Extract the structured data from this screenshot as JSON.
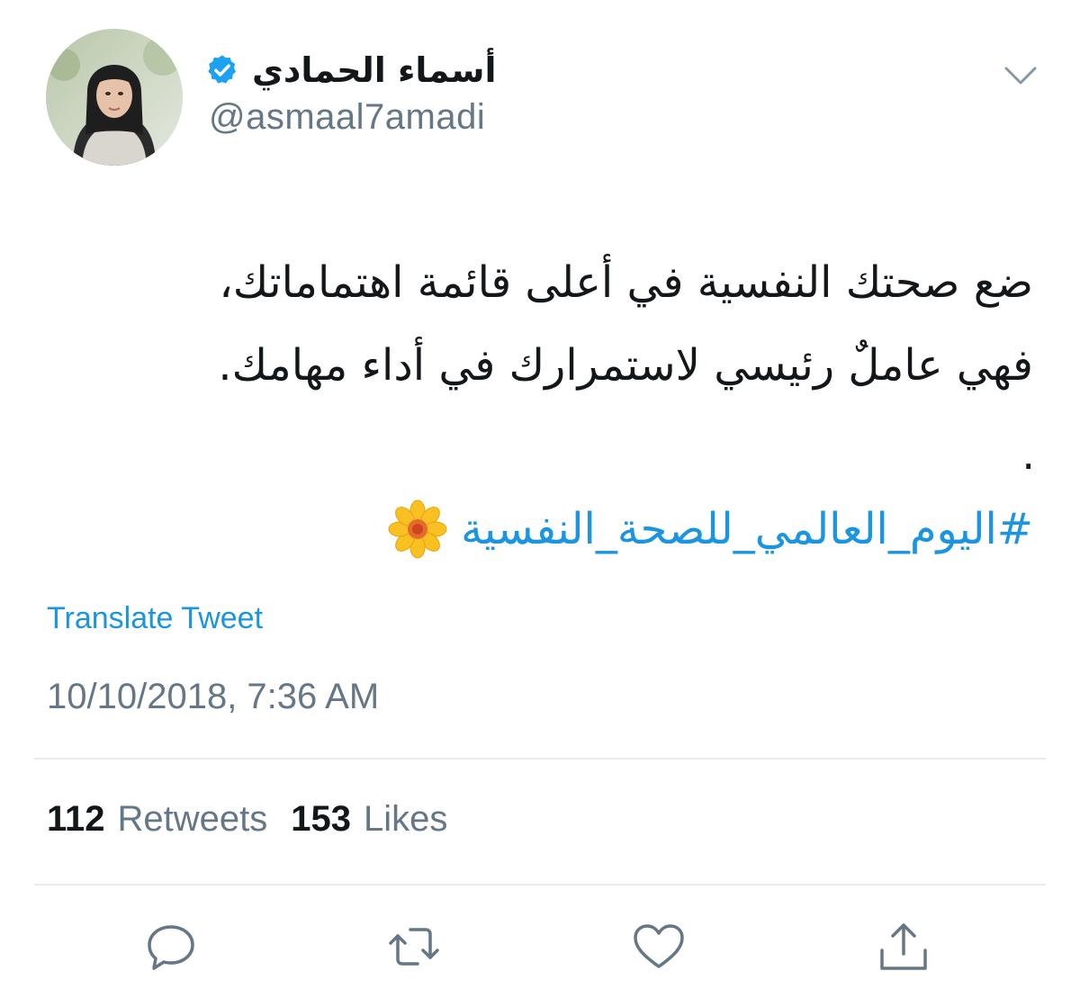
{
  "user": {
    "display_name": "أسماء الحمادي",
    "handle": "@asmaal7amadi",
    "verified": true
  },
  "tweet": {
    "lines": [
      "ضع صحتك النفسية في أعلى قائمة اهتماماتك،",
      "فهي عاملٌ رئيسي لاستمرارك في أداء مهامك."
    ],
    "dot": ".",
    "hashtag": "#اليوم_العالمي_للصحة_النفسية",
    "translate_label": "Translate Tweet",
    "timestamp": "10/10/2018, 7:36 AM"
  },
  "stats": {
    "retweets_count": "112",
    "retweets_label": "Retweets",
    "likes_count": "153",
    "likes_label": "Likes"
  },
  "icons": {
    "verified": "verified-badge-icon",
    "menu": "chevron-down-icon",
    "emoji": "sunflower-icon",
    "actions": [
      "reply-icon",
      "retweet-icon",
      "like-icon",
      "share-icon"
    ]
  },
  "colors": {
    "link_blue": "#1b95e0",
    "secondary_text": "#657786",
    "verified_blue": "#1da1f2"
  }
}
